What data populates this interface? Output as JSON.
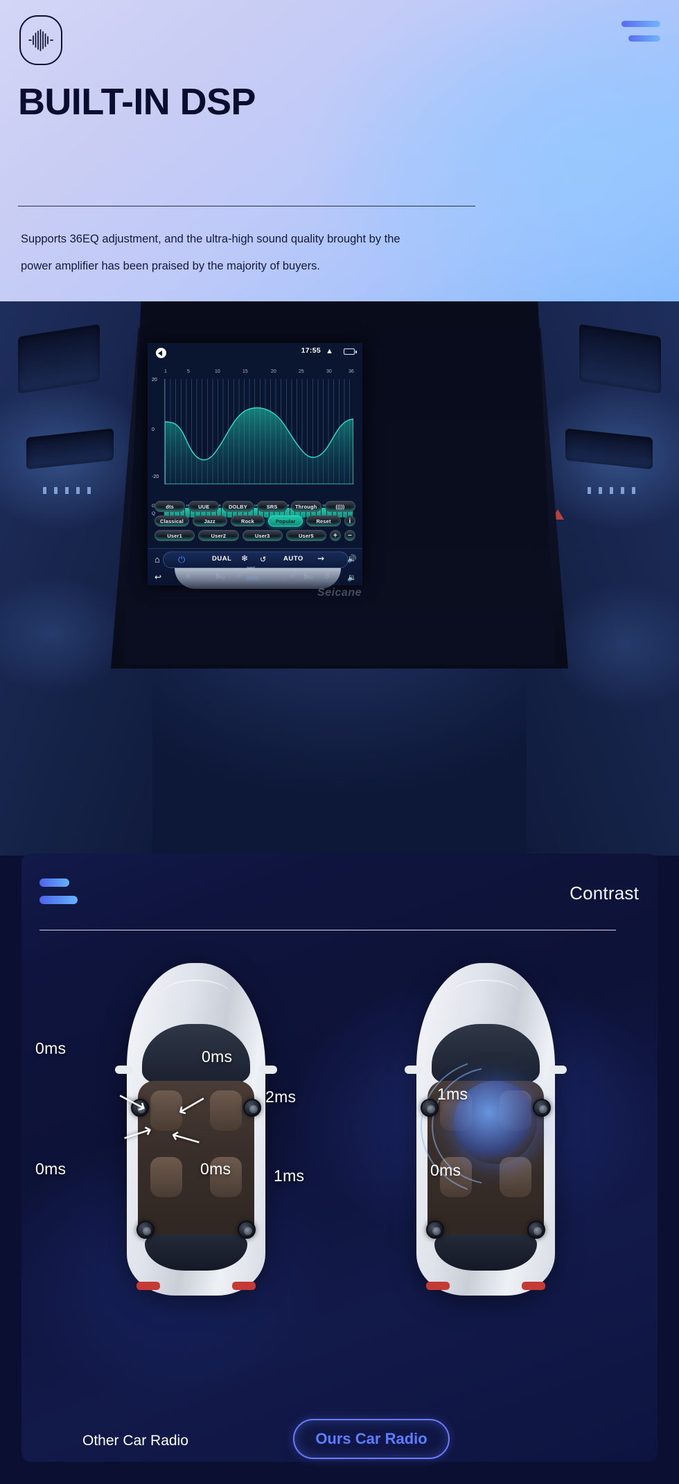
{
  "header": {
    "logo_icon": "audio-waveform-icon",
    "menu_icon": "menu-bars-icon",
    "title": "BUILT-IN DSP",
    "description_line1": "Supports 36EQ adjustment, and the ultra-high sound quality brought by the",
    "description_line2": "power amplifier has been praised by the majority of buyers.",
    "accent_color": "#5a6bf0",
    "accent_color_2": "#6fb6fb",
    "title_color": "#090d2e"
  },
  "device": {
    "brand_watermark": "Seicane",
    "status_bar": {
      "back_icon": "back-arrow-icon",
      "time": "17:55",
      "chevron_icon": "chevron-up-icon",
      "battery_icon": "battery-icon"
    },
    "eq": {
      "x_ticks": [
        "1",
        "5",
        "10",
        "15",
        "20",
        "25",
        "30",
        "36"
      ],
      "y_ticks": [
        "20",
        "0",
        "-20"
      ],
      "g_label": "G",
      "q_label": "Q",
      "band_values": [
        "16",
        "16",
        "16",
        "16",
        "16",
        "16",
        "16",
        "16",
        "16",
        "16",
        "16",
        "16",
        "16",
        "16",
        "16",
        "16",
        "16",
        "16",
        "16",
        "16",
        "16",
        "16",
        "16",
        "16",
        "16",
        "16",
        "16",
        "16",
        "16",
        "16",
        "16",
        "16",
        "16",
        "16",
        "16",
        "16"
      ],
      "gain_row": [
        "1",
        "2",
        "3",
        "4",
        "5",
        "6",
        "7",
        "8",
        "9",
        "10",
        "11",
        "12",
        "13",
        "14",
        "15",
        "16",
        "17",
        "18",
        "19",
        "20",
        "21",
        "22",
        "23",
        "24",
        "25",
        "26",
        "27",
        "28",
        "29",
        "30",
        "31",
        "32",
        "33",
        "34",
        "35",
        "36"
      ],
      "curve_color": "#1ec7ab"
    },
    "buttons": {
      "row1": [
        {
          "label": "dts",
          "active": false
        },
        {
          "label": "UUE",
          "active": false
        },
        {
          "label": "DOLBY",
          "active": false
        },
        {
          "label": "SRS",
          "active": false
        },
        {
          "label": "Through",
          "active": false
        },
        {
          "label": "((|))",
          "active": false
        }
      ],
      "row2": [
        {
          "label": "Classical",
          "active": false
        },
        {
          "label": "Jazz",
          "active": false
        },
        {
          "label": "Rock",
          "active": false
        },
        {
          "label": "Popular",
          "active": true
        },
        {
          "label": "Reset",
          "active": false
        },
        {
          "label": "i",
          "active": false
        }
      ],
      "row3": [
        {
          "label": "User1",
          "active": false
        },
        {
          "label": "User2",
          "active": false
        },
        {
          "label": "User3",
          "active": false
        },
        {
          "label": "User5",
          "active": false
        },
        {
          "label": "+",
          "active": false
        },
        {
          "label": "−",
          "active": false
        }
      ]
    },
    "climate": {
      "home_icon": "home-icon",
      "power_icon": "power-icon",
      "dual_label": "DUAL",
      "snowflake_icon": "snowflake-icon",
      "recirculate_icon": "air-recirculate-icon",
      "auto_label": "AUTO",
      "face_vent_icon": "face-vent-icon",
      "volume_up_icon": "volume-up-icon",
      "temperature": "24°C",
      "back_icon": "back-arrow-icon",
      "left_temp": "0",
      "seat_icon": "seat-icon",
      "fan_left_icon": "fan-icon",
      "fan_right_icon": "fan-icon",
      "heated_seat_icon": "heated-seat-icon",
      "right_temp": "0",
      "volume_down_icon": "volume-down-icon"
    }
  },
  "contrast": {
    "menu_icon": "menu-bars-icon",
    "title": "Contrast",
    "left_car": {
      "caption": "Other Car Radio",
      "delays": [
        "0ms",
        "0ms",
        "0ms",
        "0ms"
      ]
    },
    "right_car": {
      "caption": "Ours Car Radio",
      "delays": [
        "2ms",
        "1ms",
        "1ms",
        "0ms"
      ]
    },
    "highlight_color": "#5e7cff"
  }
}
